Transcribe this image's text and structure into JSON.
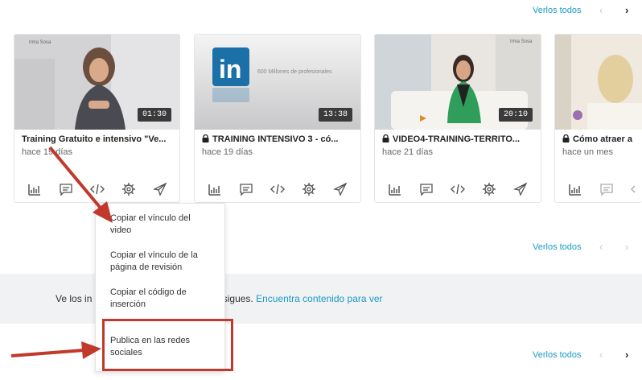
{
  "top_nav": {
    "see_all": "Verlos todos"
  },
  "videos": [
    {
      "title": "Training Gratuito e intensivo \"Ve...",
      "ago": "hace 19 días",
      "duration": "01:30",
      "locked": false
    },
    {
      "title": "TRAINING INTENSIVO 3 - có...",
      "ago": "hace 19 días",
      "duration": "13:38",
      "locked": true,
      "thumb_caption": "600 Millones de profesionales"
    },
    {
      "title": "VIDEO4-TRAINING-TERRITO...",
      "ago": "hace 21 días",
      "duration": "20:10",
      "locked": true
    },
    {
      "title": "Cómo atraer a",
      "ago": "hace un mes",
      "locked": true
    }
  ],
  "card_actions": [
    "analytics-icon",
    "comment-icon",
    "embed-icon",
    "settings-icon",
    "share-icon"
  ],
  "row2_nav": {
    "see_all": "Verlos todos"
  },
  "banner": {
    "prefix": "Ve los in",
    "middle": "que sigues.",
    "link": "Encuentra contenido para ver"
  },
  "row3_nav": {
    "see_all": "Verlos todos"
  },
  "context_menu": {
    "items": [
      {
        "label_1": "Copiar el vínculo del",
        "label_2": "video"
      },
      {
        "label_1": "Copiar el vínculo de la",
        "label_2": "página de revisión"
      },
      {
        "label_1": "Copiar el código de",
        "label_2": "inserción"
      },
      {
        "label_1": "Publica en las redes",
        "label_2": "sociales"
      }
    ]
  },
  "colors": {
    "accent": "#1a9bc4",
    "annotation": "#c0392b",
    "banner_bg": "#f1f2f4"
  }
}
